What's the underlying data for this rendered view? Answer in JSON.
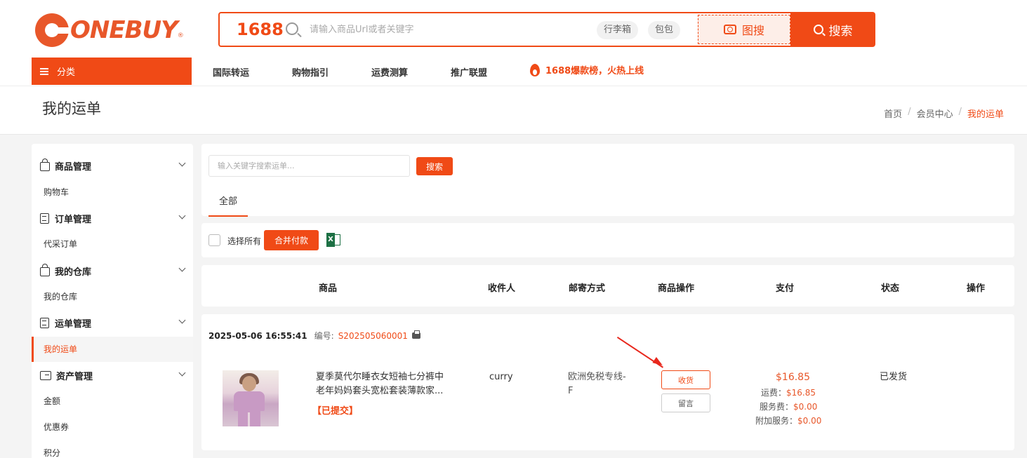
{
  "header": {
    "logo": "ONEBUY",
    "logo_mark": "®",
    "search": {
      "platform": "1688",
      "placeholder": "请输入商品Url或者关键字",
      "chips": [
        "行李箱",
        "包包"
      ],
      "image_search": "图搜",
      "button": "搜索"
    },
    "category_button": "分类",
    "nav": [
      "国际转运",
      "购物指引",
      "运费测算",
      "推广联盟"
    ],
    "hot_link": "1688爆款榜，火热上线"
  },
  "titlebar": {
    "title": "我的运单",
    "breadcrumb": [
      "首页",
      "会员中心",
      "我的运单"
    ]
  },
  "sidebar": {
    "groups": [
      {
        "label": "商品管理",
        "icon": "bag-icon",
        "items": [
          "购物车"
        ]
      },
      {
        "label": "订单管理",
        "icon": "document-icon",
        "items": [
          "代采订单"
        ]
      },
      {
        "label": "我的仓库",
        "icon": "bag-icon",
        "items": [
          "我的仓库"
        ]
      },
      {
        "label": "运单管理",
        "icon": "document-icon",
        "items": [
          "我的运单"
        ]
      },
      {
        "label": "资产管理",
        "icon": "folder-icon",
        "items": [
          "金额",
          "优惠券",
          "积分"
        ]
      }
    ],
    "active_item": "我的运单"
  },
  "filter": {
    "placeholder": "输入关键字搜索运单...",
    "search_button": "搜索",
    "tabs": [
      "全部"
    ]
  },
  "bulk": {
    "select_all": "选择所有",
    "merge_pay": "合并付款",
    "excel_icon": "excel-icon"
  },
  "table": {
    "headers": [
      "商品",
      "收件人",
      "邮寄方式",
      "商品操作",
      "支付",
      "状态",
      "操作"
    ]
  },
  "order": {
    "datetime": "2025-05-06 16:55:41",
    "number_label": "编号:",
    "number": "S202505060001",
    "product_title_line1": "夏季莫代尔睡衣女短袖七分裤中",
    "product_title_line2": "老年妈妈套头宽松套装薄款家...",
    "product_status": "【已提交】",
    "recipient": "curry",
    "shipping_line1": "欧洲免税专线-",
    "shipping_line2": "F",
    "actions": [
      "收货",
      "留言"
    ],
    "pay_total": "$16.85",
    "pay_lines": [
      {
        "label": "运费：",
        "value": "$16.85"
      },
      {
        "label": "服务费：",
        "value": "$0.00"
      },
      {
        "label": "附加服务：",
        "value": "$0.00"
      }
    ],
    "status": "已发货"
  },
  "colors": {
    "accent": "#f04a16",
    "arrow": "#e8271c",
    "price": "#e8572a",
    "excel": "#1d7044"
  }
}
